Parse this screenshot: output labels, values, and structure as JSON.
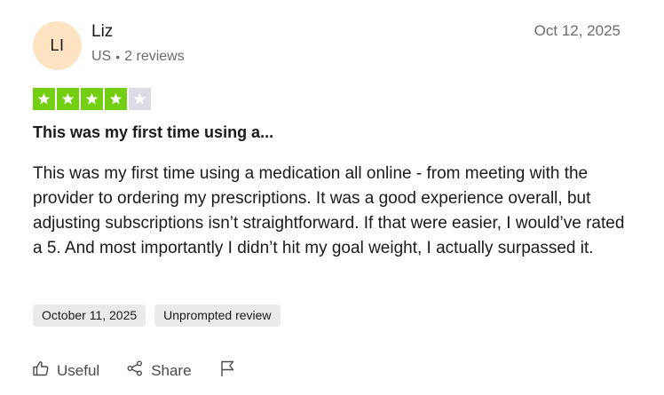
{
  "reviewer": {
    "initials": "LI",
    "name": "Liz",
    "country": "US",
    "review_count": "2 reviews"
  },
  "review": {
    "date": "Oct 12, 2025",
    "rating": 4,
    "max_rating": 5,
    "star_filled_color": "#73cf11",
    "star_empty_color": "#dcdce6",
    "title": "This was my first time using a...",
    "body": "This was my first time using a medication all online - from meeting with the provider to ordering my prescriptions. It was a good experience overall, but adjusting subscriptions isn’t straightforward. If that were easier, I would’ve rated a 5. And most importantly I didn’t hit my goal weight, I actually surpassed it.",
    "experience_date": "October 11, 2025",
    "review_type": "Unprompted review"
  },
  "actions": {
    "useful_label": "Useful",
    "share_label": "Share",
    "useful_icon": "thumbs-up-icon",
    "share_icon": "share-icon",
    "report_icon": "flag-icon"
  }
}
